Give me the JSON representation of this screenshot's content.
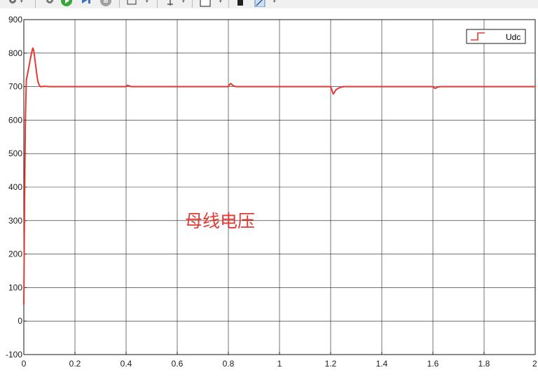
{
  "toolbar": {
    "buttons": [
      "settings-icon",
      "run-settings-icon",
      "run-icon",
      "step-forward-icon",
      "stop-icon",
      "zoom-icon",
      "cursor-icon",
      "triggers-icon",
      "fit-view-icon",
      "copy-icon",
      "style-icon"
    ]
  },
  "colors": {
    "line": "#e53935",
    "grid": "#1a1a1a",
    "annotation": "#e53935",
    "background": "#ffffff"
  },
  "annotation": "母线电压",
  "chart_data": {
    "type": "line",
    "title": "",
    "xlabel": "",
    "ylabel": "",
    "xlim": [
      0,
      2
    ],
    "ylim": [
      -100,
      900
    ],
    "grid": true,
    "legend_position": "top-right",
    "x_ticks": [
      "0",
      "0.2",
      "0.4",
      "0.6",
      "0.8",
      "1",
      "1.2",
      "1.4",
      "1.6",
      "1.8",
      "2"
    ],
    "y_ticks": [
      "900",
      "800",
      "700",
      "600",
      "500",
      "400",
      "300",
      "200",
      "100",
      "0",
      "-100"
    ],
    "series": [
      {
        "name": "Udc",
        "x": [
          0,
          0.003,
          0.006,
          0.01,
          0.015,
          0.02,
          0.025,
          0.03,
          0.035,
          0.038,
          0.042,
          0.046,
          0.05,
          0.055,
          0.06,
          0.065,
          0.07,
          0.08,
          0.1,
          0.2,
          0.4,
          0.405,
          0.41,
          0.415,
          0.42,
          0.43,
          0.6,
          0.8,
          0.805,
          0.81,
          0.815,
          0.82,
          0.83,
          0.84,
          1.0,
          1.2,
          1.205,
          1.21,
          1.215,
          1.22,
          1.23,
          1.24,
          1.25,
          1.4,
          1.6,
          1.605,
          1.61,
          1.615,
          1.62,
          1.63,
          1.8,
          2.0
        ],
        "values": [
          50,
          360,
          600,
          720,
          740,
          760,
          780,
          800,
          815,
          810,
          790,
          765,
          740,
          715,
          705,
          700,
          700,
          701,
          700,
          700,
          700,
          704,
          703,
          701,
          700,
          700,
          700,
          700,
          707,
          709,
          705,
          702,
          700,
          700,
          700,
          700,
          690,
          678,
          683,
          690,
          695,
          698,
          700,
          700,
          700,
          696,
          695,
          697,
          699,
          700,
          700,
          700
        ]
      }
    ]
  }
}
